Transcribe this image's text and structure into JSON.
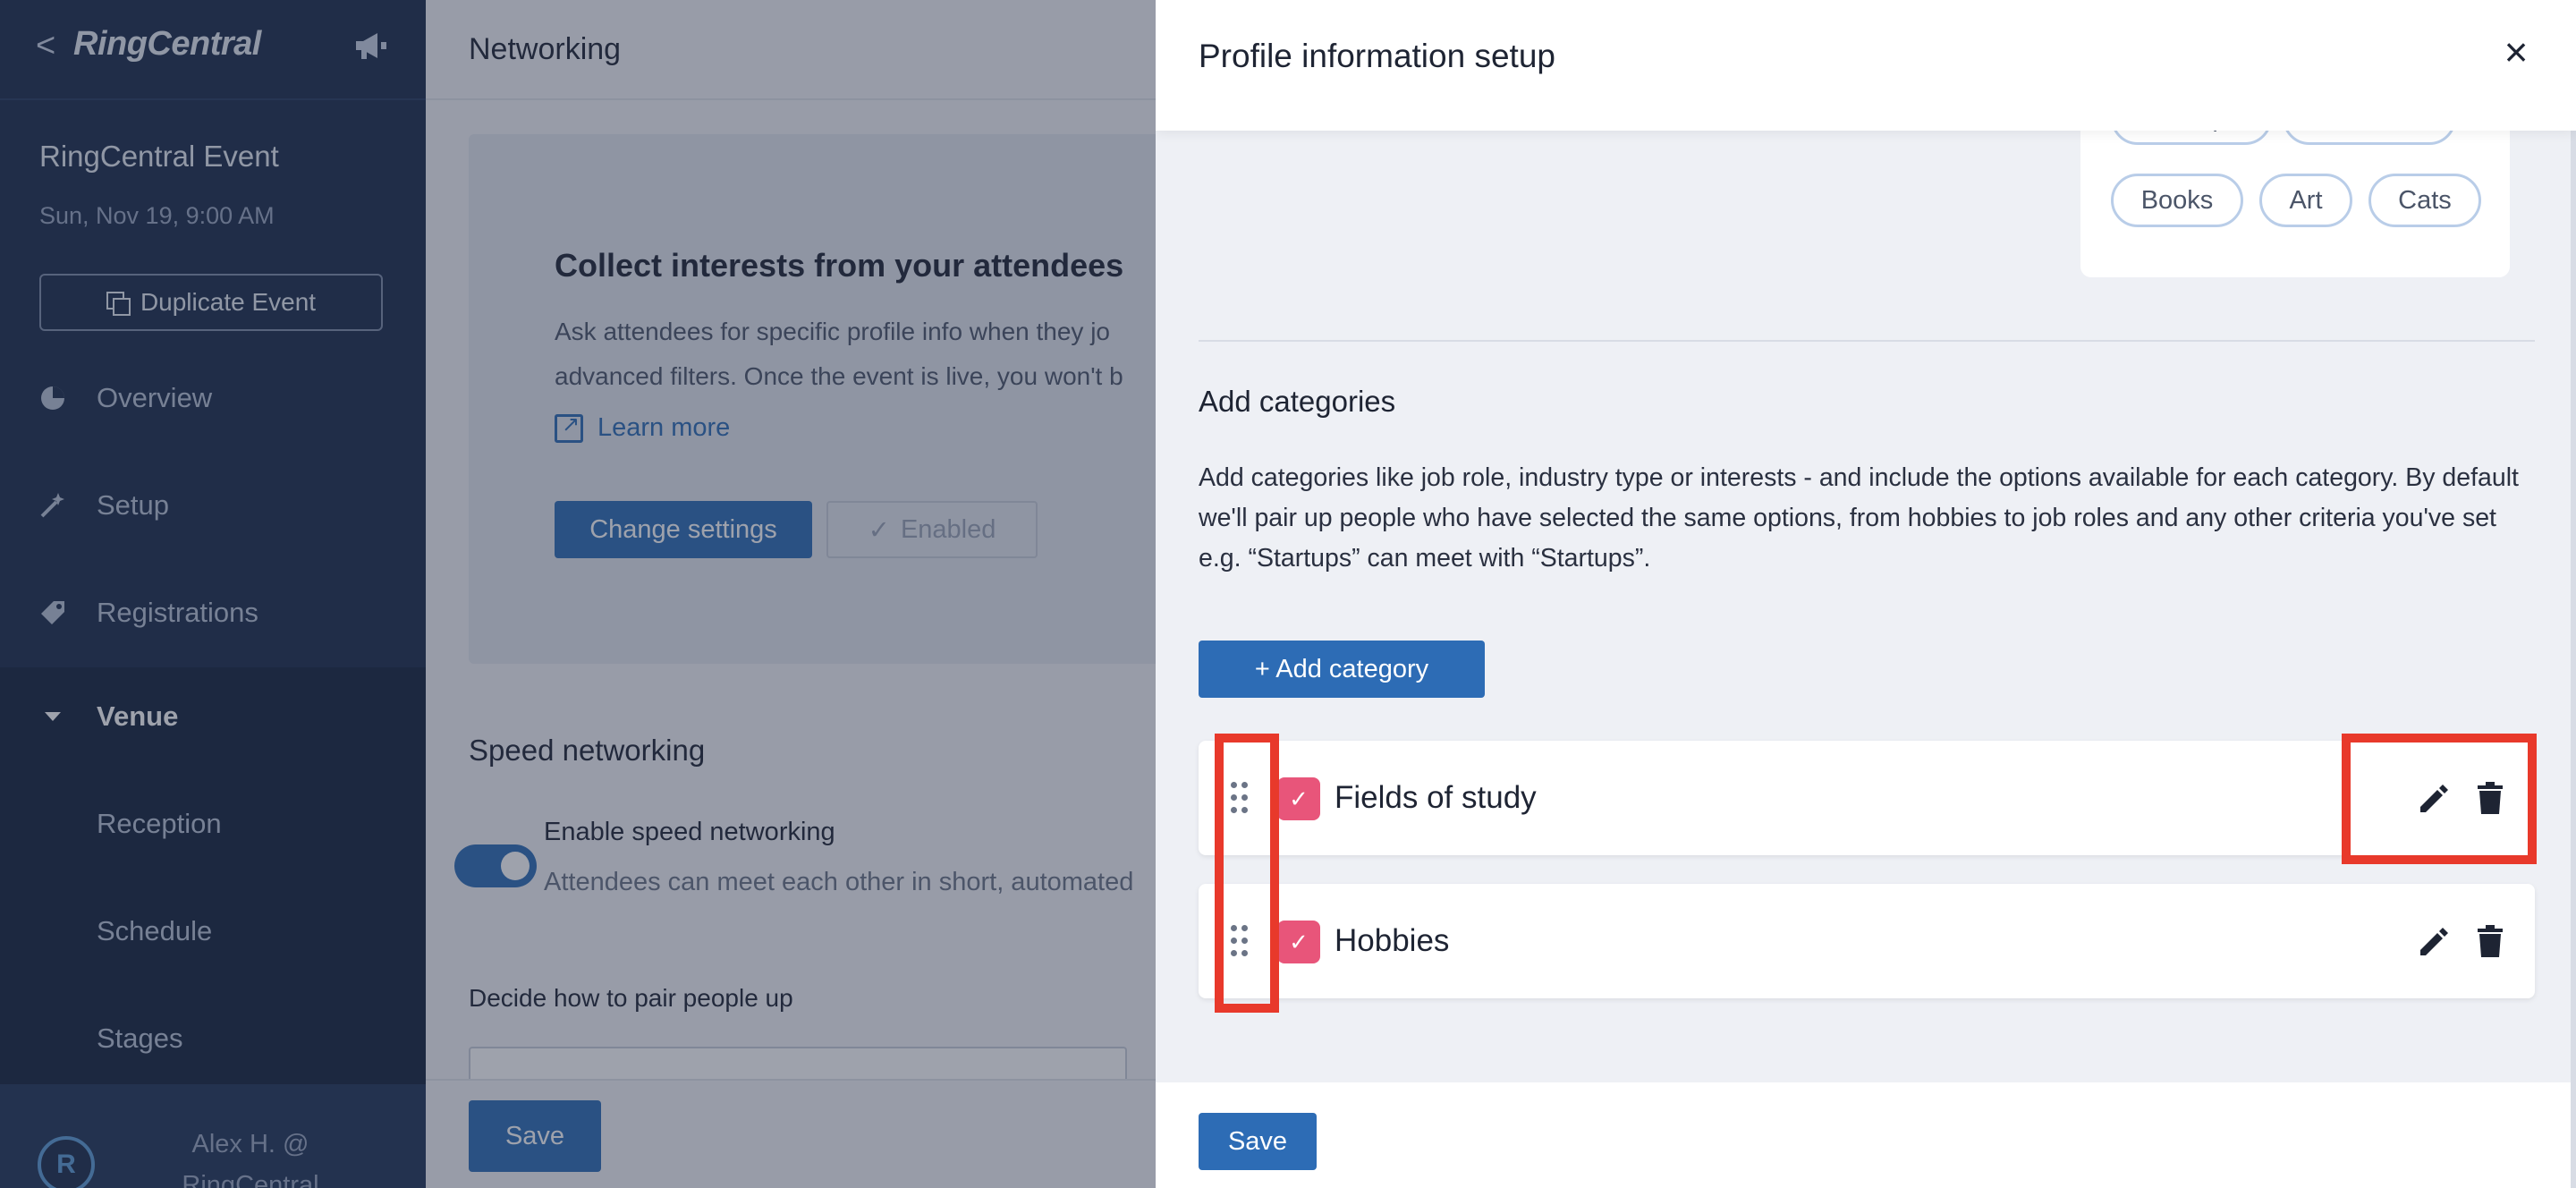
{
  "sidebar": {
    "back": "<",
    "logo": "RingCentral",
    "event_title": "RingCentral Event",
    "event_date": "Sun, Nov 19, 9:00 AM",
    "duplicate_label": "Duplicate Event",
    "items": [
      {
        "label": "Overview",
        "icon": "pie-chart-icon"
      },
      {
        "label": "Setup",
        "icon": "magic-wand-icon"
      },
      {
        "label": "Registrations",
        "icon": "tag-icon"
      },
      {
        "label": "Venue",
        "icon": "caret-down-icon"
      },
      {
        "label": "Reception"
      },
      {
        "label": "Schedule"
      },
      {
        "label": "Stages"
      }
    ],
    "user_line1": "Alex H. @",
    "user_line2": "RingCentral"
  },
  "main": {
    "title": "Networking",
    "collect_title": "Collect interests from your attendees",
    "collect_text_1": "Ask attendees for specific profile info when they jo",
    "collect_text_2": "advanced filters. Once the event is live, you won't b",
    "learn_more": "Learn more",
    "change_settings": "Change settings",
    "enabled": "Enabled",
    "speed_title": "Speed networking",
    "speed_label": "Enable speed networking",
    "speed_desc": "Attendees can meet each other in short, automated",
    "pair_label": "Decide how to pair people up",
    "save": "Save"
  },
  "panel": {
    "title": "Profile information setup",
    "close": "×",
    "tags": [
      "Startups",
      "Business",
      "Books",
      "Art",
      "Cats"
    ],
    "cat_title": "Add categories",
    "cat_desc": "Add categories like job role, industry type or interests - and include the options available for each category. By default we'll pair up people who have selected the same options, from hobbies to job roles and any other criteria you've set e.g. “Startups” can meet with “Startups”.",
    "add_category": "+ Add category",
    "categories": [
      {
        "name": "Fields of study"
      },
      {
        "name": "Hobbies"
      }
    ],
    "save": "Save"
  },
  "colors": {
    "sidebar_bg": "#1a2b4a",
    "primary": "#2d6cb5",
    "check_pink": "#e8557a",
    "highlight_red": "#e8392b"
  }
}
